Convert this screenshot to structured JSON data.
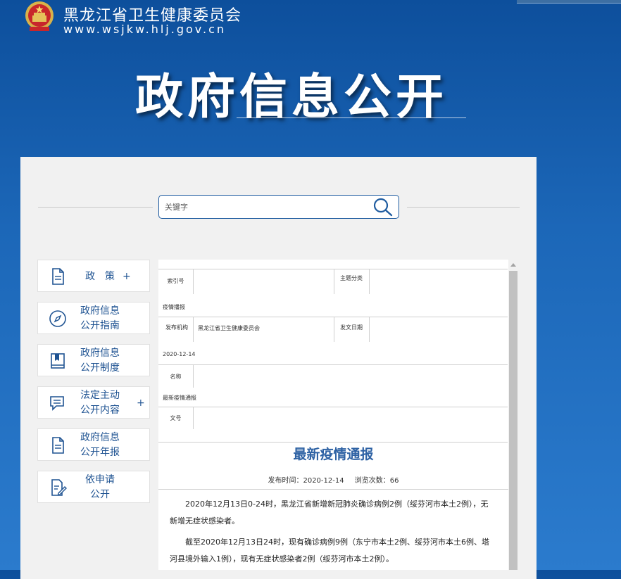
{
  "header": {
    "site_name": "黑龙江省卫生健康委员会",
    "site_url": "www.wsjkw.hlj.gov.cn",
    "page_title": "政府信息公开"
  },
  "search": {
    "placeholder": "关键字"
  },
  "sidebar": {
    "items": [
      {
        "label": "政　策",
        "icon": "document-icon",
        "has_plus": true
      },
      {
        "label": "政府信息\n公开指南",
        "icon": "compass-icon",
        "has_plus": false
      },
      {
        "label": "政府信息\n公开制度",
        "icon": "book-icon",
        "has_plus": false
      },
      {
        "label": "法定主动\n公开内容",
        "icon": "message-icon",
        "has_plus": true
      },
      {
        "label": "政府信息\n公开年报",
        "icon": "report-icon",
        "has_plus": false
      },
      {
        "label": "依申请\n公开",
        "icon": "edit-document-icon",
        "has_plus": false
      }
    ],
    "plus_symbol": "+"
  },
  "meta": {
    "index_label": "索引号",
    "index_value": "",
    "topic_label": "主题分类",
    "topic_value": "疫情播报",
    "issuer_label": "发布机构",
    "issuer_value": "黑龙江省卫生健康委员会",
    "date_label": "发文日期",
    "date_value": "2020-12-14",
    "name_label": "名称",
    "name_value": "最新疫情通报",
    "docno_label": "文号",
    "docno_value": ""
  },
  "article": {
    "title": "最新疫情通报",
    "publish_time": "发布时间：2020-12-14",
    "views": "浏览次数：66",
    "paragraphs": [
      "2020年12月13日0-24时，黑龙江省新增新冠肺炎确诊病例2例（绥芬河市本土2例），无新增无症状感染者。",
      "截至2020年12月13日24时，现有确诊病例9例（东宁市本土2例、绥芬河市本土6例、塔河县境外输入1例），现有无症状感染者2例（绥芬河市本土2例）。"
    ]
  },
  "colors": {
    "header_blue": "#0d4f9c",
    "link_blue": "#1f5392",
    "title_blue": "#2e62a4"
  }
}
